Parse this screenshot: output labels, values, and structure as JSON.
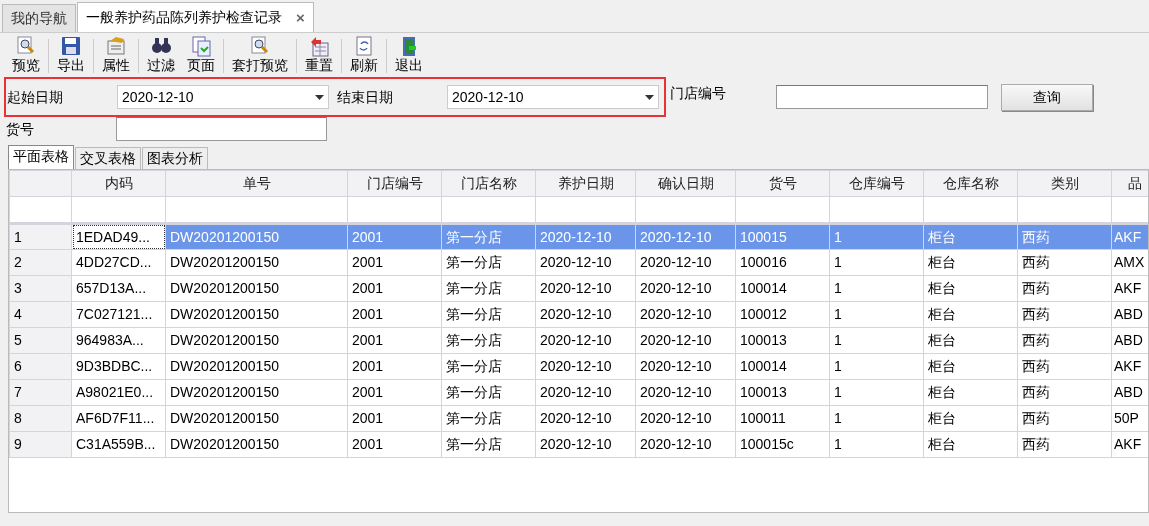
{
  "doc_tabs": [
    {
      "label": "我的导航",
      "selected": false,
      "closable": false
    },
    {
      "label": "一般养护药品陈列养护检查记录",
      "selected": true,
      "closable": true,
      "close": "×"
    }
  ],
  "toolbar": [
    {
      "label": "预览",
      "group_end": true
    },
    {
      "label": "导出",
      "group_end": true
    },
    {
      "label": "属性",
      "group_end": true
    },
    {
      "label": "过滤",
      "group_end": false
    },
    {
      "label": "页面",
      "group_end": true
    },
    {
      "label": "套打预览",
      "group_end": true
    },
    {
      "label": "重置",
      "group_end": true
    },
    {
      "label": "刷新",
      "group_end": true
    },
    {
      "label": "退出",
      "group_end": false
    }
  ],
  "filters": {
    "highlighted": true,
    "start_label": "起始日期",
    "start_value": "2020-12-10",
    "end_label": "结束日期",
    "end_value": "2020-12-10",
    "store_label": "门店编号",
    "query_button": "查询",
    "item_label": "货号"
  },
  "view_tabs": [
    {
      "label": "平面表格",
      "selected": true
    },
    {
      "label": "交叉表格",
      "selected": false
    },
    {
      "label": "图表分析",
      "selected": false
    }
  ],
  "table": {
    "columns": [
      "内码",
      "单号",
      "门店编号",
      "门店名称",
      "养护日期",
      "确认日期",
      "货号",
      "仓库编号",
      "仓库名称",
      "类别",
      "品"
    ],
    "rows": [
      {
        "index": "1",
        "selected": true,
        "cells": [
          "1EDAD49...",
          "DW20201200150",
          "2001",
          "第一分店",
          "2020-12-10",
          "2020-12-10",
          "100015",
          "1",
          "柜台",
          "西药",
          "AKF"
        ]
      },
      {
        "index": "2",
        "selected": false,
        "cells": [
          "4DD27CD...",
          "DW20201200150",
          "2001",
          "第一分店",
          "2020-12-10",
          "2020-12-10",
          "100016",
          "1",
          "柜台",
          "西药",
          "AMX"
        ]
      },
      {
        "index": "3",
        "selected": false,
        "cells": [
          "657D13A...",
          "DW20201200150",
          "2001",
          "第一分店",
          "2020-12-10",
          "2020-12-10",
          "100014",
          "1",
          "柜台",
          "西药",
          "AKF"
        ]
      },
      {
        "index": "4",
        "selected": false,
        "cells": [
          "7C027121...",
          "DW20201200150",
          "2001",
          "第一分店",
          "2020-12-10",
          "2020-12-10",
          "100012",
          "1",
          "柜台",
          "西药",
          "ABD"
        ]
      },
      {
        "index": "5",
        "selected": false,
        "cells": [
          "964983A...",
          "DW20201200150",
          "2001",
          "第一分店",
          "2020-12-10",
          "2020-12-10",
          "100013",
          "1",
          "柜台",
          "西药",
          "ABD"
        ]
      },
      {
        "index": "6",
        "selected": false,
        "cells": [
          "9D3BDBC...",
          "DW20201200150",
          "2001",
          "第一分店",
          "2020-12-10",
          "2020-12-10",
          "100014",
          "1",
          "柜台",
          "西药",
          "AKF"
        ]
      },
      {
        "index": "7",
        "selected": false,
        "cells": [
          "A98021E0...",
          "DW20201200150",
          "2001",
          "第一分店",
          "2020-12-10",
          "2020-12-10",
          "100013",
          "1",
          "柜台",
          "西药",
          "ABD"
        ]
      },
      {
        "index": "8",
        "selected": false,
        "cells": [
          "AF6D7F11...",
          "DW20201200150",
          "2001",
          "第一分店",
          "2020-12-10",
          "2020-12-10",
          "100011",
          "1",
          "柜台",
          "西药",
          "50P"
        ]
      },
      {
        "index": "9",
        "selected": false,
        "cells": [
          "C31A559B...",
          "DW20201200150",
          "2001",
          "第一分店",
          "2020-12-10",
          "2020-12-10",
          "100015c",
          "1",
          "柜台",
          "西药",
          "AKF"
        ]
      }
    ]
  }
}
